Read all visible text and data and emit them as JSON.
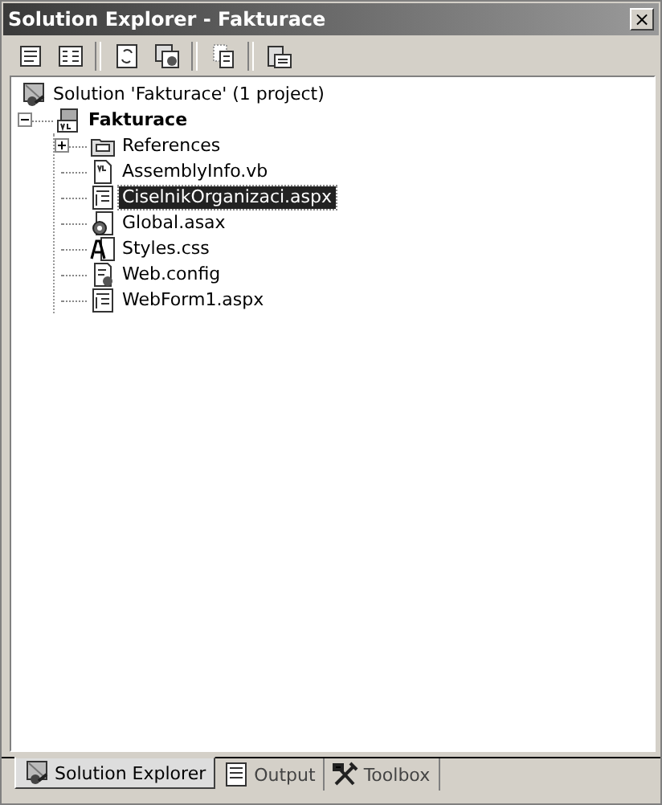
{
  "window": {
    "title": "Solution Explorer - Fakturace",
    "close": "×"
  },
  "toolbar": [
    {
      "kind": "list"
    },
    {
      "kind": "panel"
    },
    {
      "kind": "refresh"
    },
    {
      "kind": "window"
    },
    {
      "kind": "copy"
    },
    {
      "kind": "cabinet"
    }
  ],
  "tree": [
    {
      "label": "Solution 'Fakturace' (1 project)",
      "kind": "solution",
      "selected": false,
      "children": [
        {
          "label": "Fakturace",
          "kind": "project",
          "bold": true,
          "expanded": true,
          "selected": false,
          "children": [
            {
              "label": "References",
              "kind": "references",
              "expanded": false,
              "selected": false
            },
            {
              "label": "AssemblyInfo.vb",
              "kind": "vb",
              "selected": false
            },
            {
              "label": "CiselnikOrganizaci.aspx",
              "kind": "aspx",
              "selected": true
            },
            {
              "label": "Global.asax",
              "kind": "asax",
              "selected": false
            },
            {
              "label": "Styles.css",
              "kind": "css",
              "selected": false
            },
            {
              "label": "Web.config",
              "kind": "config",
              "selected": false
            },
            {
              "label": "WebForm1.aspx",
              "kind": "aspx",
              "selected": false
            }
          ]
        }
      ]
    }
  ],
  "tabs": [
    {
      "label": "Solution Explorer",
      "kind": "solution",
      "selected": true
    },
    {
      "label": "Output",
      "kind": "output",
      "selected": false
    },
    {
      "label": "Toolbox",
      "kind": "toolbox",
      "selected": false
    }
  ]
}
